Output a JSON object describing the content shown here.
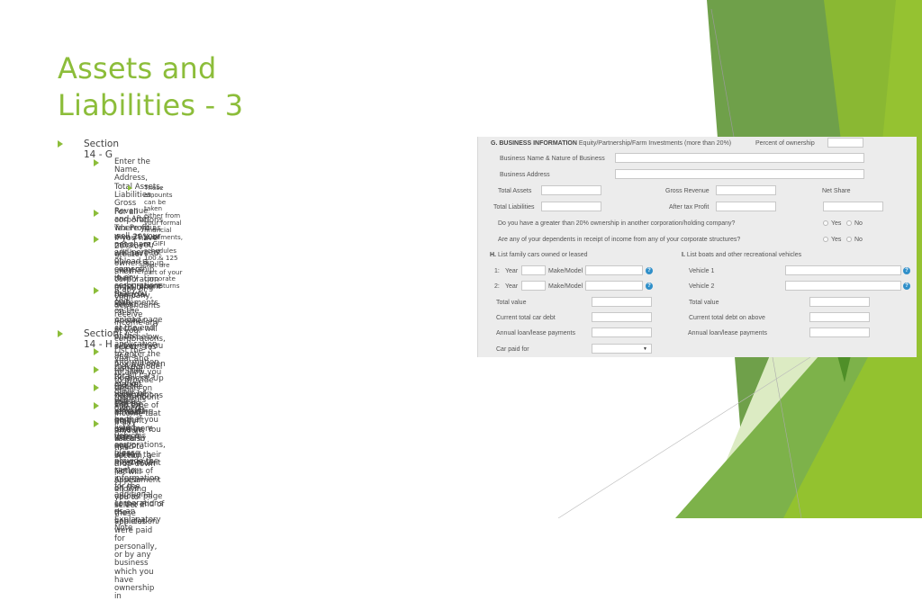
{
  "slide": {
    "title_line1": "Assets and",
    "title_line2": "Liabilities - 3",
    "accent_color": "#8cbd3a"
  },
  "bullets": {
    "section_g": {
      "label": "Section 14 - G",
      "items": [
        {
          "lines": [
            "Enter the Name, Address, Total Assets, Liabilities, Gross Revenue and After Tax Profit as",
            "well as your net share and percent of ownership in any corporations that you own."
          ],
          "sub": [
            "These amounts can be taken either from your formal financial statements, or GIFI schedules",
            "100 & 125 that are part of your corporate tax returns"
          ]
        },
        {
          "lines": [
            "For all corporations where you own 20% or more, you will have to upload a copy of their",
            "most recent financial statements on the upload page at the end of the application"
          ]
        },
        {
          "lines": [
            "If you have 20% or greater ownership in another corporation or holding company, select",
            "“Yes”. Another section will open below allowing you to enter the information for that",
            "business. Up to 4 corporations can be entered here. If you own more than 4 corporations,",
            "please provide the same information for the additional corporations as an Explanatory",
            "Note"
          ]
        },
        {
          "lines": [
            "If any of your dependants receive income any of your corporations, select “Yes” and a",
            "box will open to allow you to provide details on the amount and type of income that they",
            "receive. You will also need to upload their most recent Notices of Assessment on the",
            "upload page at the end of the application"
          ]
        }
      ]
    },
    "section_h": {
      "label": "Section 14 - H",
      "items": [
        {
          "lines": [
            "List the year and make/model for all cars and/or other vehicles owned"
          ]
        },
        {
          "lines": [
            "List the total market value of these vehicles"
          ]
        },
        {
          "lines": [
            "List the total debt still remaining on the listed vehicles"
          ]
        },
        {
          "lines": [
            "List the annual amount paid in loan and/or lease payments"
          ]
        },
        {
          "lines": [
            "If any amount listed in this section, a drop-down list will appear allowing you to select if",
            "these vehicles were paid for personally, or by any business which you have ownership in"
          ]
        }
      ]
    }
  },
  "form": {
    "g_heading_bold": "G. BUSINESS INFORMATION",
    "g_heading_rest": "Equity/Partnership/Farm Investments (more than 20%)",
    "percent_ownership_label": "Percent of ownership",
    "percent_ownership_value": "",
    "business_name_label": "Business Name & Nature of Business",
    "business_name_value": "",
    "business_address_label": "Business Address",
    "business_address_value": "",
    "total_assets_label": "Total Assets",
    "total_assets_value": "",
    "gross_revenue_label": "Gross Revenue",
    "gross_revenue_value": "",
    "net_share_label": "Net Share",
    "net_share_value": "",
    "total_liabilities_label": "Total Liabilities",
    "total_liabilities_value": "",
    "after_tax_profit_label": "After tax Profit",
    "after_tax_profit_value": "",
    "q_ownership": "Do you have a greater than 20% ownership in another corporation/holding company?",
    "q_dependents": "Are any of your dependents in receipt of income from any of your corporate structures?",
    "yes_label": "Yes",
    "no_label": "No",
    "h_heading_bold": "H.",
    "h_heading_rest": "List family cars owned or leased",
    "i_heading_bold": "I.",
    "i_heading_rest": "List boats and other recreational vehicles",
    "car1_num": "1:",
    "car2_num": "2:",
    "year_label": "Year",
    "make_model_label": "Make/Model",
    "vehicle1_label": "Vehicle 1",
    "vehicle2_label": "Vehicle 2",
    "h_total_value_label": "Total value",
    "h_current_debt_label": "Current total car debt",
    "h_annual_label": "Annual loan/lease payments",
    "car_paid_for_label": "Car paid for",
    "car_paid_for_value": "",
    "i_total_value_label": "Total value",
    "i_current_debt_label": "Current total debt on above",
    "i_annual_label": "Annual loan/lease payments",
    "help_glyph": "?",
    "dropdown_glyph": "▼"
  }
}
